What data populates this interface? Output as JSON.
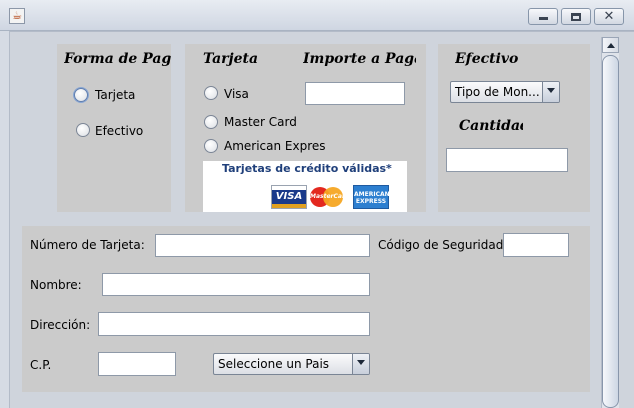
{
  "window": {
    "icon": "java-icon",
    "controls": [
      "minimize-icon",
      "maximize-icon",
      "close-icon"
    ]
  },
  "forma_pago": {
    "header": "Forma de Pago",
    "options": [
      {
        "label": "Tarjeta",
        "selected": true
      },
      {
        "label": "Efectivo",
        "selected": false
      }
    ]
  },
  "tarjeta": {
    "header": "Tarjeta",
    "importe_header": "Importe a Pagar",
    "importe_value": "",
    "options": [
      {
        "label": "Visa",
        "selected": false
      },
      {
        "label": "Master Card",
        "selected": false
      },
      {
        "label": "American Expres",
        "selected": false
      }
    ],
    "cards_image": {
      "title": "Tarjetas de crédito válidas*",
      "logos": [
        "VISA",
        "MasterCard",
        "AMERICAN EXPRESS"
      ]
    }
  },
  "efectivo": {
    "header": "Efectivo",
    "moneda_combo": "Tipo de Mon...",
    "cantidad_label": "Cantidad",
    "cantidad_value": ""
  },
  "datos": {
    "numero_label": "Número de Tarjeta:",
    "numero_value": "",
    "codigo_label": "Código de Seguridad",
    "codigo_value": "",
    "nombre_label": "Nombre:",
    "nombre_value": "",
    "direccion_label": "Dirección:",
    "direccion_value": "",
    "cp_label": "C.P.",
    "cp_value": "",
    "pais_combo": "Seleccione un Pais"
  },
  "colors": {
    "window_bg": "#d6dbe4",
    "panel_bg": "#cbcbcb",
    "field_bg": "#ffffff",
    "card_title": "#1f3f7a"
  }
}
